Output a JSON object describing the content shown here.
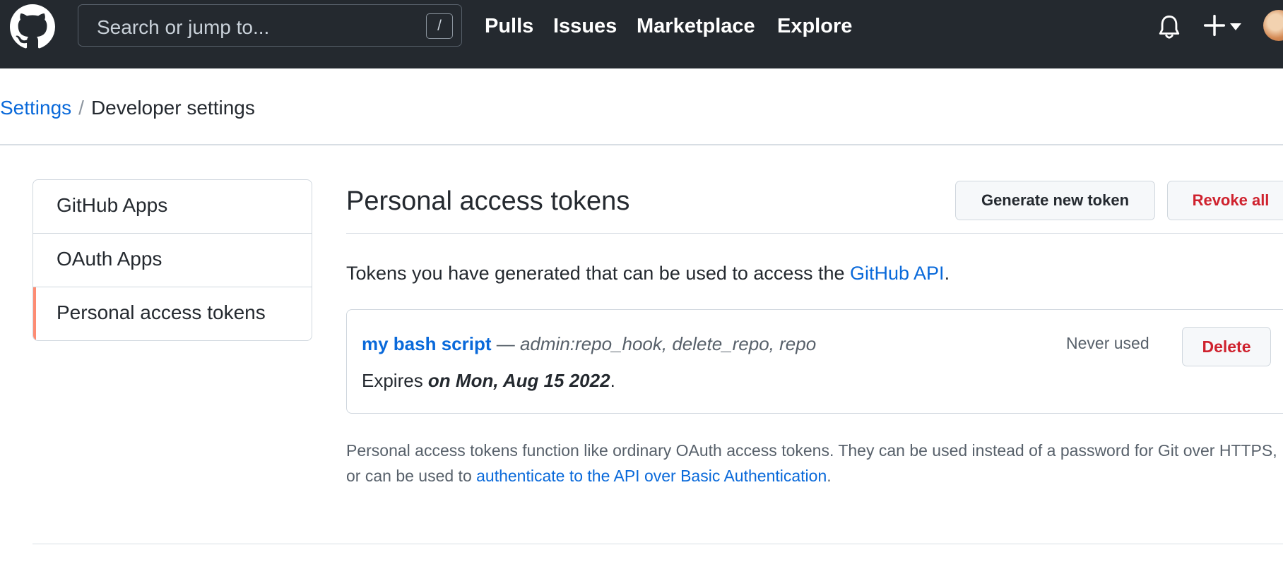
{
  "header": {
    "logo_icon": "github-mark-icon",
    "search_placeholder": "Search or jump to...",
    "search_shortcut": "/",
    "nav": [
      "Pulls",
      "Issues",
      "Marketplace",
      "Explore"
    ],
    "icons": [
      "bell-icon",
      "plus-icon",
      "caret-down-icon",
      "avatar"
    ]
  },
  "breadcrumb": {
    "parent": "Settings",
    "separator": "/",
    "current": "Developer settings"
  },
  "sidebar": {
    "items": [
      {
        "label": "GitHub Apps"
      },
      {
        "label": "OAuth Apps"
      },
      {
        "label": "Personal access tokens"
      }
    ],
    "selected_index": 2
  },
  "main": {
    "title": "Personal access tokens",
    "generate_label": "Generate new token",
    "revoke_label": "Revoke all",
    "intro_text": "Tokens you have generated that can be used to access the ",
    "intro_link": "GitHub API",
    "intro_end": "."
  },
  "token": {
    "name": "my bash script",
    "dash": " — ",
    "scopes": "admin:repo_hook, delete_repo, repo",
    "expires_prefix": "Expires ",
    "expires_date": "on Mon, Aug 15 2022",
    "expires_end": ".",
    "usage": "Never used",
    "delete_label": "Delete"
  },
  "note": {
    "text": "Personal access tokens function like ordinary OAuth access tokens. They can be used instead of a password for Git over HTTPS, or can be used to ",
    "link": "authenticate to the API over Basic Authentication",
    "end": "."
  },
  "colors": {
    "header_bg": "#24292f",
    "link": "#0969da",
    "danger": "#cf222e",
    "selected_accent": "#fd8c73"
  }
}
